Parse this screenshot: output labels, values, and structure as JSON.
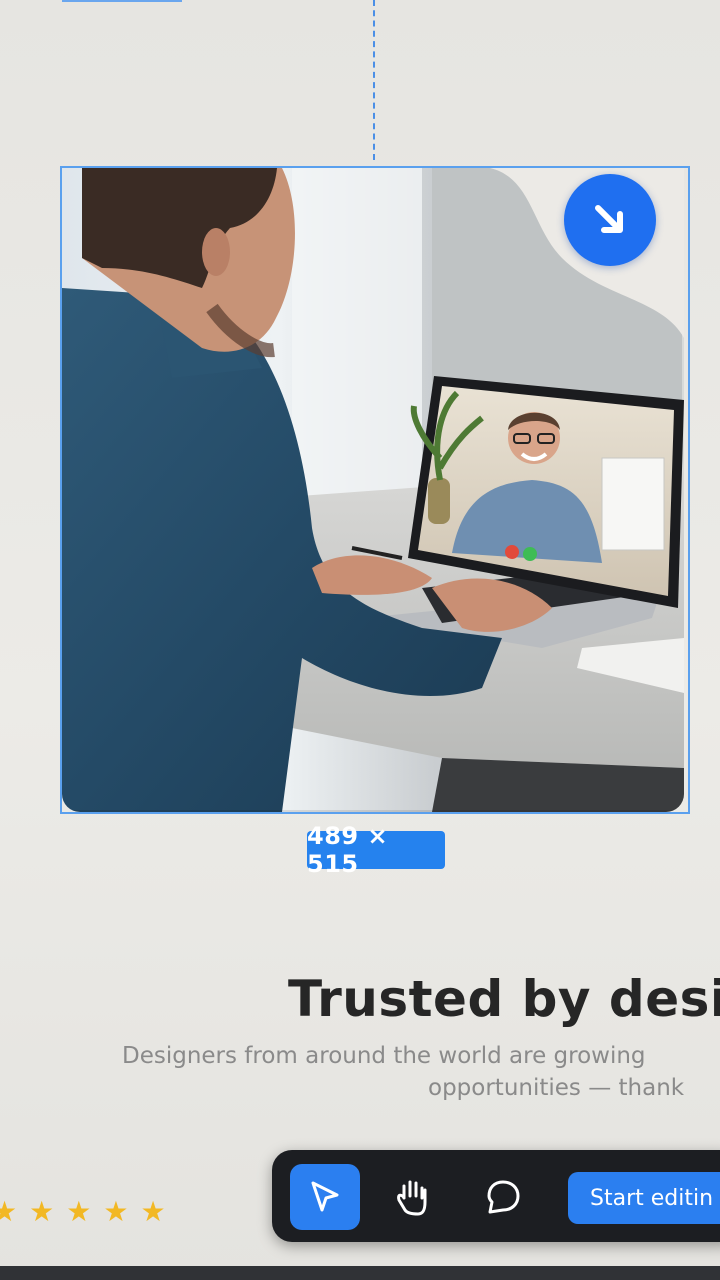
{
  "image_card": {
    "size_label": "489 × 515",
    "corner_icon": "arrow-down-right-icon",
    "accent_color": "#1f6ff0"
  },
  "section": {
    "headline": "Trusted by desig",
    "subtitle_line1": "Designers from around the world are growing",
    "subtitle_line2": "opportunities — thank"
  },
  "rating": {
    "stars": 5,
    "star_color": "#f2b824"
  },
  "toolbar": {
    "tools": [
      {
        "name": "cursor-icon",
        "active": true
      },
      {
        "name": "hand-icon",
        "active": false
      },
      {
        "name": "comment-icon",
        "active": false
      }
    ],
    "start_label": "Start editin"
  }
}
